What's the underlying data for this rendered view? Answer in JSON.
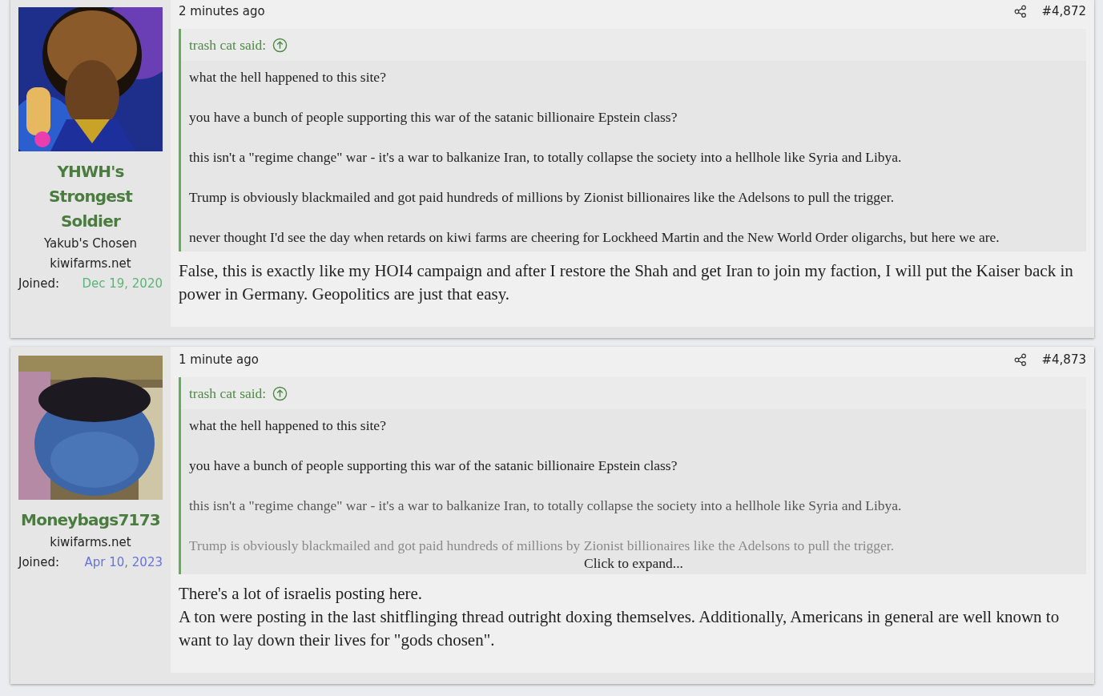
{
  "posts": [
    {
      "user": {
        "name": "YHWH's Strongest Soldier",
        "title": "Yakub's Chosen",
        "site": "kiwifarms.net",
        "joined_label": "Joined:",
        "joined": "Dec 19, 2020",
        "color": "#5cb377"
      },
      "time": "2 minutes ago",
      "number": "#4,872",
      "quote": {
        "author": "trash cat said:",
        "collapsed": false,
        "paragraphs": [
          "what the hell happened to this site?",
          "you have a bunch of people supporting this war of the satanic billionaire Epstein class?",
          "this isn't a \"regime change\" war - it's a war to balkanize Iran, to totally collapse the society into a hellhole like Syria and Libya.",
          "Trump is obviously blackmailed and got paid hundreds of millions by Zionist billionaires like the Adelsons to pull the trigger.",
          "never thought I'd see the day when retards on kiwi farms are cheering for Lockheed Martin and the New World Order oligarchs, but here we are."
        ]
      },
      "body": [
        "False, this is exactly like my HOI4 campaign and after I restore the Shah and get Iran to join my faction, I will put the Kaiser back in power in Germany. Geopolitics are just that easy."
      ]
    },
    {
      "user": {
        "name": "Moneybags7173",
        "site": "kiwifarms.net",
        "joined_label": "Joined:",
        "joined": "Apr 10, 2023",
        "color": "#6673e0"
      },
      "time": "1 minute ago",
      "number": "#4,873",
      "quote": {
        "author": "trash cat said:",
        "collapsed": true,
        "expand": "Click to expand...",
        "paragraphs": [
          "what the hell happened to this site?",
          "you have a bunch of people supporting this war of the satanic billionaire Epstein class?",
          "this isn't a \"regime change\" war - it's a war to balkanize Iran, to totally collapse the society into a hellhole like Syria and Libya.",
          "Trump is obviously blackmailed and got paid hundreds of millions by Zionist billionaires like the Adelsons to pull the trigger."
        ]
      },
      "body": [
        "There's a lot of israelis posting here.",
        "A ton were posting in the last shitflinging thread outright doxing themselves. Additionally, Americans in general are well known to want to lay down their lives for \"gods chosen\"."
      ]
    }
  ]
}
